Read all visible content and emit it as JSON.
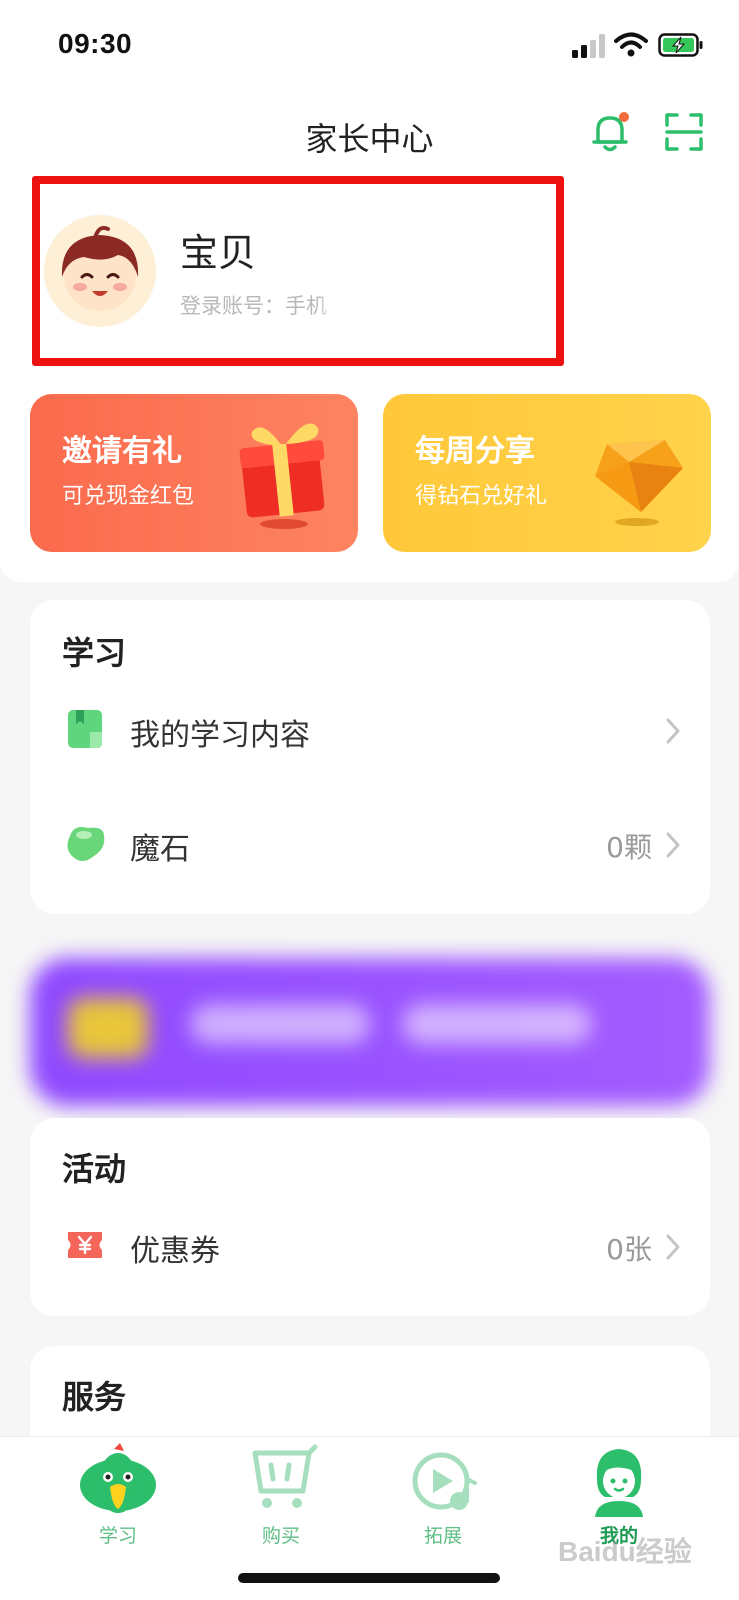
{
  "status_bar": {
    "time": "09:30"
  },
  "header": {
    "title": "家长中心"
  },
  "profile": {
    "nickname": "宝贝",
    "account_label": "登录账号：手机"
  },
  "promos": [
    {
      "title": "邀请有礼",
      "subtitle": "可兑现金红包",
      "icon": "gift-icon"
    },
    {
      "title": "每周分享",
      "subtitle": "得钻石兑好礼",
      "icon": "diamond-icon"
    }
  ],
  "study_section": {
    "title": "学习",
    "items": [
      {
        "label": "我的学习内容",
        "value": "",
        "icon": "book-icon"
      },
      {
        "label": "魔石",
        "value": "0颗",
        "icon": "magic-stone-icon"
      }
    ]
  },
  "activity_section": {
    "title": "活动",
    "items": [
      {
        "label": "优惠券",
        "value": "0张",
        "icon": "coupon-icon"
      }
    ]
  },
  "service_section": {
    "title": "服务"
  },
  "tabs": [
    {
      "label": "学习",
      "icon": "parrot-icon"
    },
    {
      "label": "购买",
      "icon": "cart-icon"
    },
    {
      "label": "拓展",
      "icon": "music-play-icon"
    },
    {
      "label": "我的",
      "icon": "profile-person-icon",
      "active": true
    }
  ],
  "watermark": "Baidu经验",
  "colors": {
    "accent_green": "#2dbe6c",
    "invite_red": "#fb6a4d",
    "share_yellow": "#ffc83a",
    "banner_purple": "#9750ff",
    "highlight_red": "#ee1111"
  }
}
